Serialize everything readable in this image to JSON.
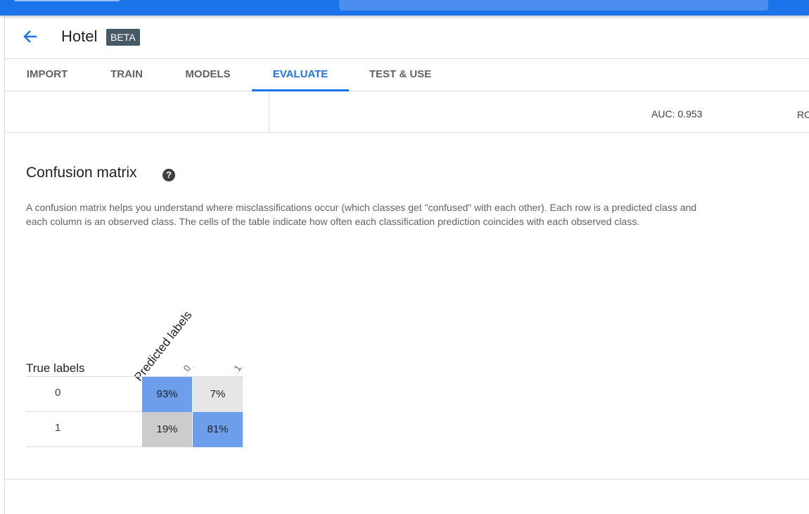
{
  "header": {
    "title": "Hotel",
    "badge": "BETA"
  },
  "tabs": [
    {
      "label": "IMPORT",
      "active": false
    },
    {
      "label": "TRAIN",
      "active": false
    },
    {
      "label": "MODELS",
      "active": false
    },
    {
      "label": "EVALUATE",
      "active": true
    },
    {
      "label": "TEST & USE",
      "active": false
    }
  ],
  "metrics": {
    "auc": "AUC: 0.953",
    "roc_partial": "RC"
  },
  "confusion": {
    "title": "Confusion matrix",
    "help_icon": "help-circle-icon",
    "description": "A confusion matrix helps you understand where misclassifications occur (which classes get \"confused\" with each other). Each row is a predicted class and each column is an observed class. The cells of the table indicate how often each classification prediction coincides with each observed class.",
    "true_labels": "True labels",
    "predicted_labels": "Predicted labels",
    "columns": [
      "0",
      "1"
    ],
    "rows": [
      {
        "label": "0",
        "cells": [
          "93%",
          "7%"
        ]
      },
      {
        "label": "1",
        "cells": [
          "19%",
          "81%"
        ]
      }
    ]
  },
  "colors": {
    "accent": "#1a73e8",
    "cell_high": "#6d9eeb",
    "cell_light_gray": "#e6e6e6",
    "cell_gray": "#cccccc",
    "badge": "#455a64"
  }
}
